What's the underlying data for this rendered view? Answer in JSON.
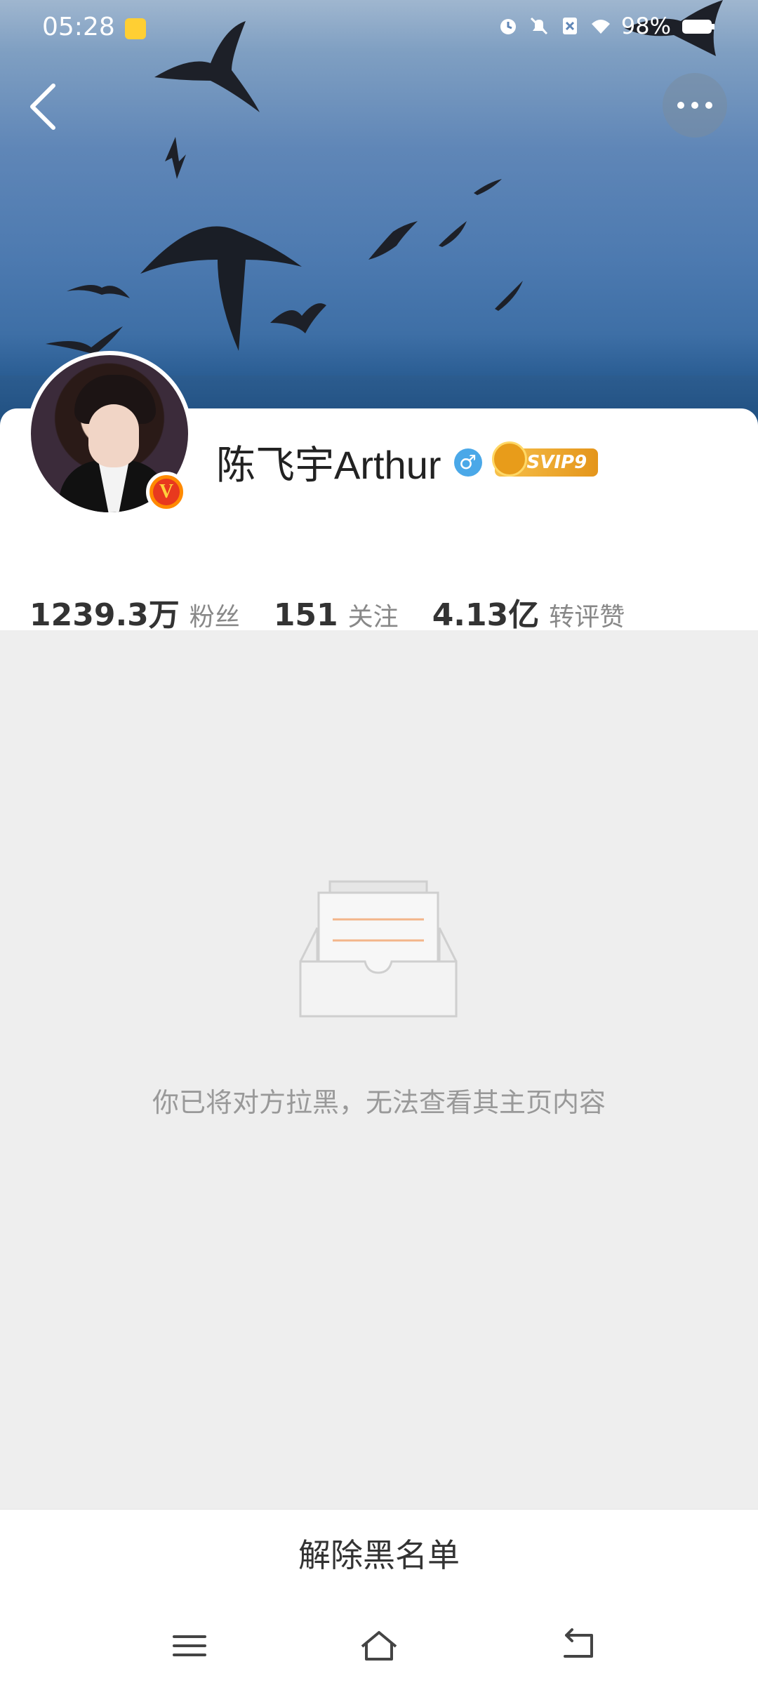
{
  "status_bar": {
    "time": "05:28",
    "battery": "98%"
  },
  "profile": {
    "name": "陈飞宇Arthur",
    "gender_symbol": "♂",
    "vip_label": "SVIP9",
    "verified_badge": "V",
    "stats": [
      {
        "value": "1239.3万",
        "label": "粉丝"
      },
      {
        "value": "151",
        "label": "关注"
      },
      {
        "value": "4.13亿",
        "label": "转评赞"
      }
    ]
  },
  "blocked_message": "你已将对方拉黑，无法查看其主页内容",
  "unblock_button": "解除黑名单",
  "colors": {
    "accent_orange": "#ff8a00",
    "vip_gold": "#e4951b",
    "gender_blue": "#4aa8e8"
  }
}
